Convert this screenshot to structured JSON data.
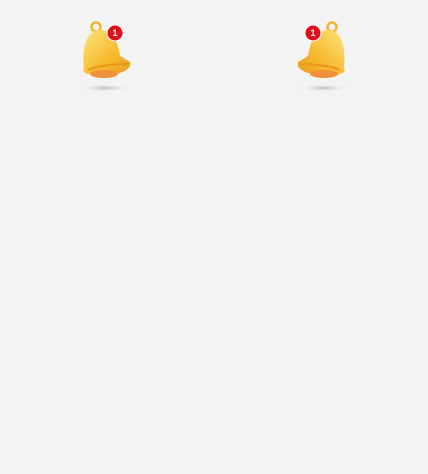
{
  "notifications": [
    {
      "icon": "bell-icon",
      "badge_count": "1",
      "orientation": "normal"
    },
    {
      "icon": "bell-icon",
      "badge_count": "1",
      "orientation": "mirrored"
    }
  ],
  "colors": {
    "background": "#f3f3f3",
    "bell": "#f7c23a",
    "badge": "#e0101b"
  }
}
